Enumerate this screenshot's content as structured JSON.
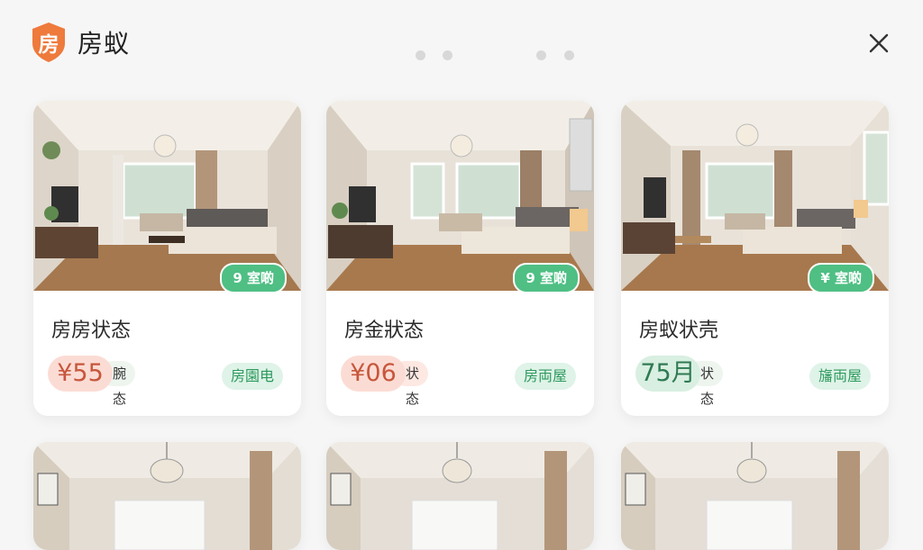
{
  "header": {
    "logo_glyph": "房",
    "app_name": "房蚁"
  },
  "colors": {
    "brand_orange": "#ee7a3c",
    "accent_green": "#4fbf84",
    "price_pink_bg": "#fbdcd4",
    "price_pink_text": "#c7563c",
    "price_green_bg": "#d8efe1",
    "price_green_text": "#2f7a53"
  },
  "listings": [
    {
      "title": "房房状态",
      "price": "¥55",
      "price_suffix": "腕态",
      "status": "房園电",
      "photo_tag": "9 室啲",
      "price_theme": "pink"
    },
    {
      "title": "房金狀态",
      "price": "¥06",
      "price_suffix": "状态",
      "status": "房両屋",
      "photo_tag": "9 室啲",
      "price_theme": "pink"
    },
    {
      "title": "房蚁状壳",
      "price": "75月",
      "price_suffix": "状态",
      "status": "旛両屋",
      "photo_tag": "¥ 室啲",
      "price_theme": "green"
    }
  ],
  "icons": {
    "logo": "house-shield-icon",
    "close": "close-icon"
  }
}
